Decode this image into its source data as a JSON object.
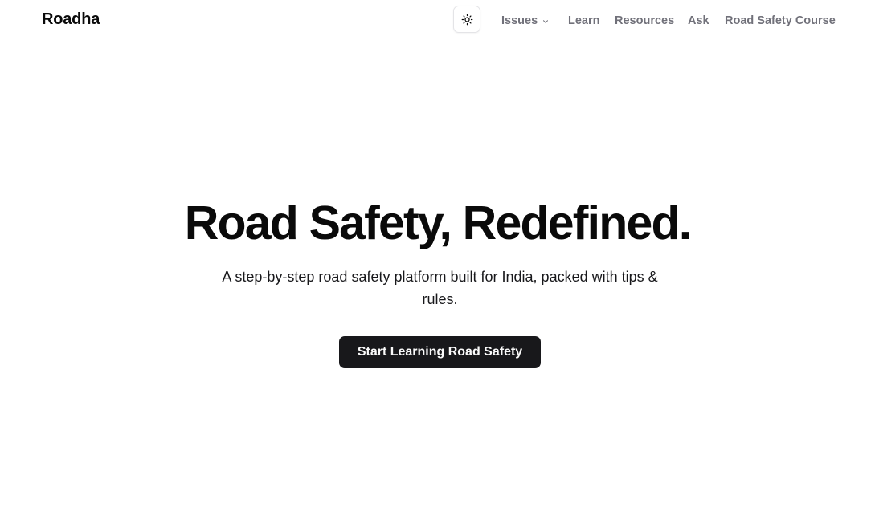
{
  "header": {
    "brand": "Roadha",
    "theme_toggle_icon": "sun-icon",
    "nav": {
      "issues": "Issues",
      "issues_icon": "chevron-down-icon",
      "learn": "Learn",
      "resources": "Resources",
      "ask": "Ask",
      "course": "Road Safety Course"
    }
  },
  "hero": {
    "title": "Road Safety, Redefined.",
    "subtitle": "A step-by-step road safety platform built for India, packed with tips & rules.",
    "cta_label": "Start Learning Road Safety"
  },
  "colors": {
    "background": "#ffffff",
    "text": "#0a0a0a",
    "nav_text": "#71717a",
    "button_bg": "#18181b",
    "button_text": "#fafafa"
  }
}
